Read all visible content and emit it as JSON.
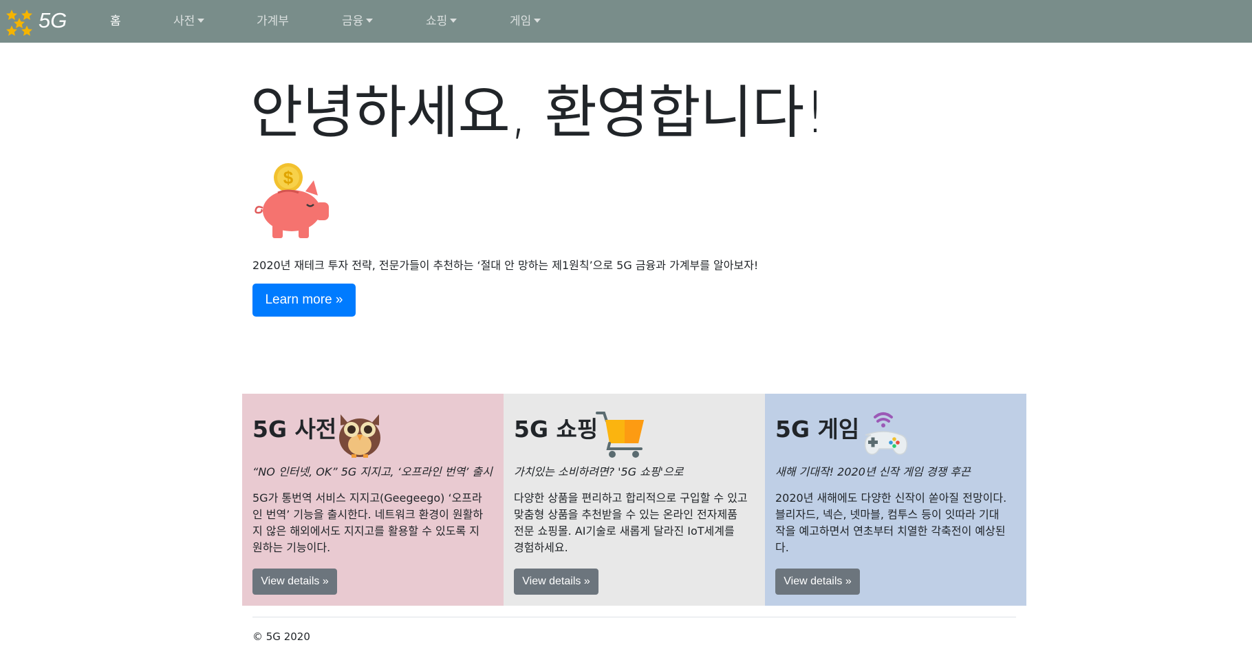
{
  "navbar": {
    "brand": "5G",
    "items": [
      {
        "label": "홈",
        "dropdown": false
      },
      {
        "label": "사전",
        "dropdown": true
      },
      {
        "label": "가계부",
        "dropdown": false
      },
      {
        "label": "금융",
        "dropdown": true
      },
      {
        "label": "쇼핑",
        "dropdown": true
      },
      {
        "label": "게임",
        "dropdown": true
      }
    ]
  },
  "hero": {
    "title": "안녕하세요, 환영합니다!",
    "description": "2020년 재테크 투자 전략, 전문가들이 추천하는 ‘절대 안 망하는 제1원칙’으로 5G 금융과 가계부를 알아보자!",
    "button_label": "Learn more »",
    "icon": "piggy-bank-icon"
  },
  "cards": [
    {
      "title": "5G 사전",
      "icon": "owl-icon",
      "subtitle": "“NO 인터넷, OK” 5G 지지고, ‘오프라인 번역’ 출시",
      "body": "5G가 통번역 서비스 지지고(Geegeego) ‘오프라인 번역’ 기능을 출시한다. 네트워크 환경이 원활하지 않은 해외에서도 지지고를 활용할 수 있도록 지원하는 기능이다.",
      "button_label": "View details »",
      "background": "#e9cad1"
    },
    {
      "title": "5G 쇼핑",
      "icon": "shopping-cart-icon",
      "subtitle": "가치있는 소비하려면? '5G 쇼핑'으로",
      "body": "다양한 상품을 편리하고 합리적으로 구입할 수 있고 맞춤형 상품을 추천받을 수 있는 온라인 전자제품 전문 쇼핑몰. AI기술로 새롭게 달라진 IoT세계를 경험하세요.",
      "button_label": "View details »",
      "background": "#e8e8e8"
    },
    {
      "title": "5G 게임",
      "icon": "game-controller-icon",
      "subtitle": "새해 기대작! 2020년 신작 게임 경쟁 후끈",
      "body": "2020년 새해에도 다양한 신작이 쏟아질 전망이다. 블리자드, 넥슨, 넷마블, 컴투스 등이 잇따라 기대작을 예고하면서 연초부터 치열한 각축전이 예상된다.",
      "button_label": "View details »",
      "background": "#bfcfe6"
    }
  ],
  "footer": {
    "text": "© 5G 2020"
  },
  "colors": {
    "navbar": "#798d8a",
    "primary": "#007bff",
    "secondary": "#6c757d",
    "star": "#f5b400"
  }
}
